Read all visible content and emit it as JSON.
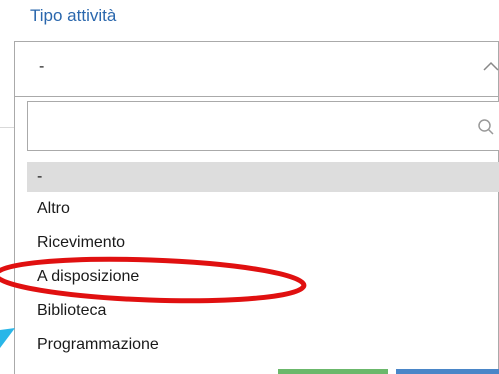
{
  "field": {
    "label": "Tipo attività",
    "selected_value": "-",
    "search_placeholder": ""
  },
  "options": [
    "-",
    "Altro",
    "Ricevimento",
    "A disposizione",
    "Biblioteca",
    "Programmazione"
  ],
  "colors": {
    "label": "#2a67ad",
    "highlight_ellipse": "#e01010",
    "arrow": "#29b6e8",
    "selected_option_bg": "#dddddd"
  },
  "icons": [
    "chevron-up-icon",
    "search-icon"
  ]
}
